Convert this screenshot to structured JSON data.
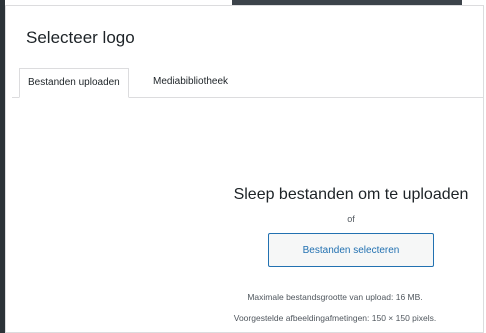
{
  "dialog": {
    "title": "Selecteer logo"
  },
  "tabs": [
    {
      "label": "Bestanden uploaden",
      "active": true
    },
    {
      "label": "Mediabibliotheek",
      "active": false
    }
  ],
  "uploader": {
    "drop_text": "Sleep bestanden om te uploaden",
    "or_text": "of",
    "select_button": "Bestanden selecteren",
    "max_size": "Maximale bestandsgrootte van upload: 16 MB.",
    "suggested_dimensions": "Voorgestelde afbeeldingafmetingen: 150 × 150 pixels."
  },
  "colors": {
    "accent": "#2271b1",
    "text": "#1d2327",
    "muted": "#50575e",
    "border": "#dcdcde"
  }
}
